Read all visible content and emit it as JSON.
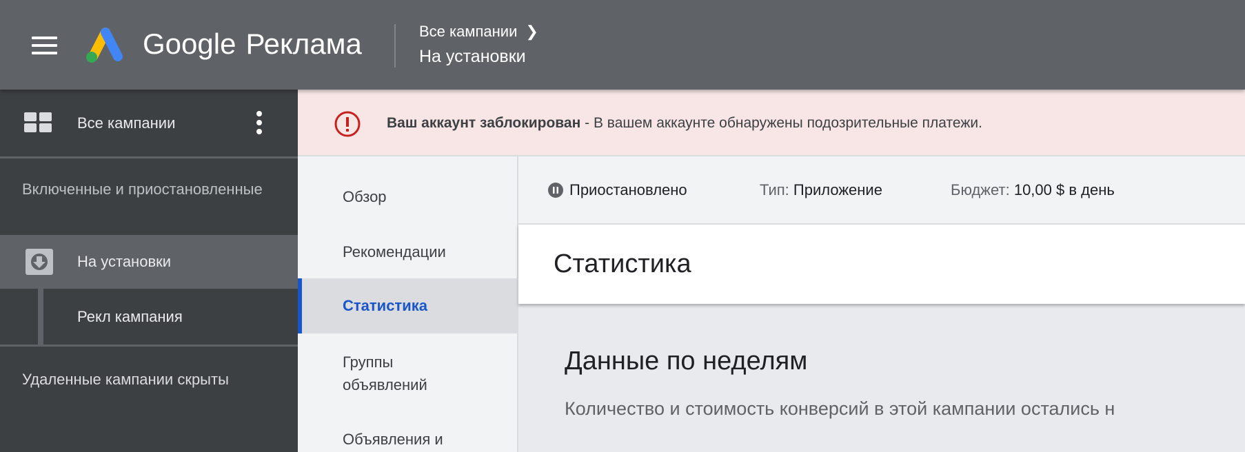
{
  "header": {
    "brand": "Google",
    "product": "Реклама",
    "breadcrumb_parent": "Все кампании",
    "breadcrumb_current": "На установки"
  },
  "sidebar": {
    "all_campaigns": "Все кампании",
    "filter_label": "Включенные и приостановленные",
    "campaign": "На установки",
    "ad_campaign": "Рекл кампания",
    "deleted_hidden": "Удаленные кампании скрыты"
  },
  "banner": {
    "title": "Ваш аккаунт заблокирован",
    "message": " - В вашем аккаунте обнаружены подозрительные платежи."
  },
  "nav": {
    "items": [
      {
        "label": "Обзор"
      },
      {
        "label": "Рекомендации"
      },
      {
        "label": "Статистика"
      },
      {
        "label": "Группы объявлений"
      },
      {
        "label": "Объявления и"
      }
    ]
  },
  "status": {
    "state": "Приостановлено",
    "type_label": "Тип:",
    "type_value": "Приложение",
    "budget_label": "Бюджет:",
    "budget_value": "10,00 $ в день"
  },
  "main": {
    "page_title": "Статистика",
    "section_title": "Данные по неделям",
    "section_desc": "Количество и стоимость конверсий в этой кампании остались н"
  },
  "colors": {
    "accent": "#1a56c8",
    "error": "#c5221f"
  }
}
